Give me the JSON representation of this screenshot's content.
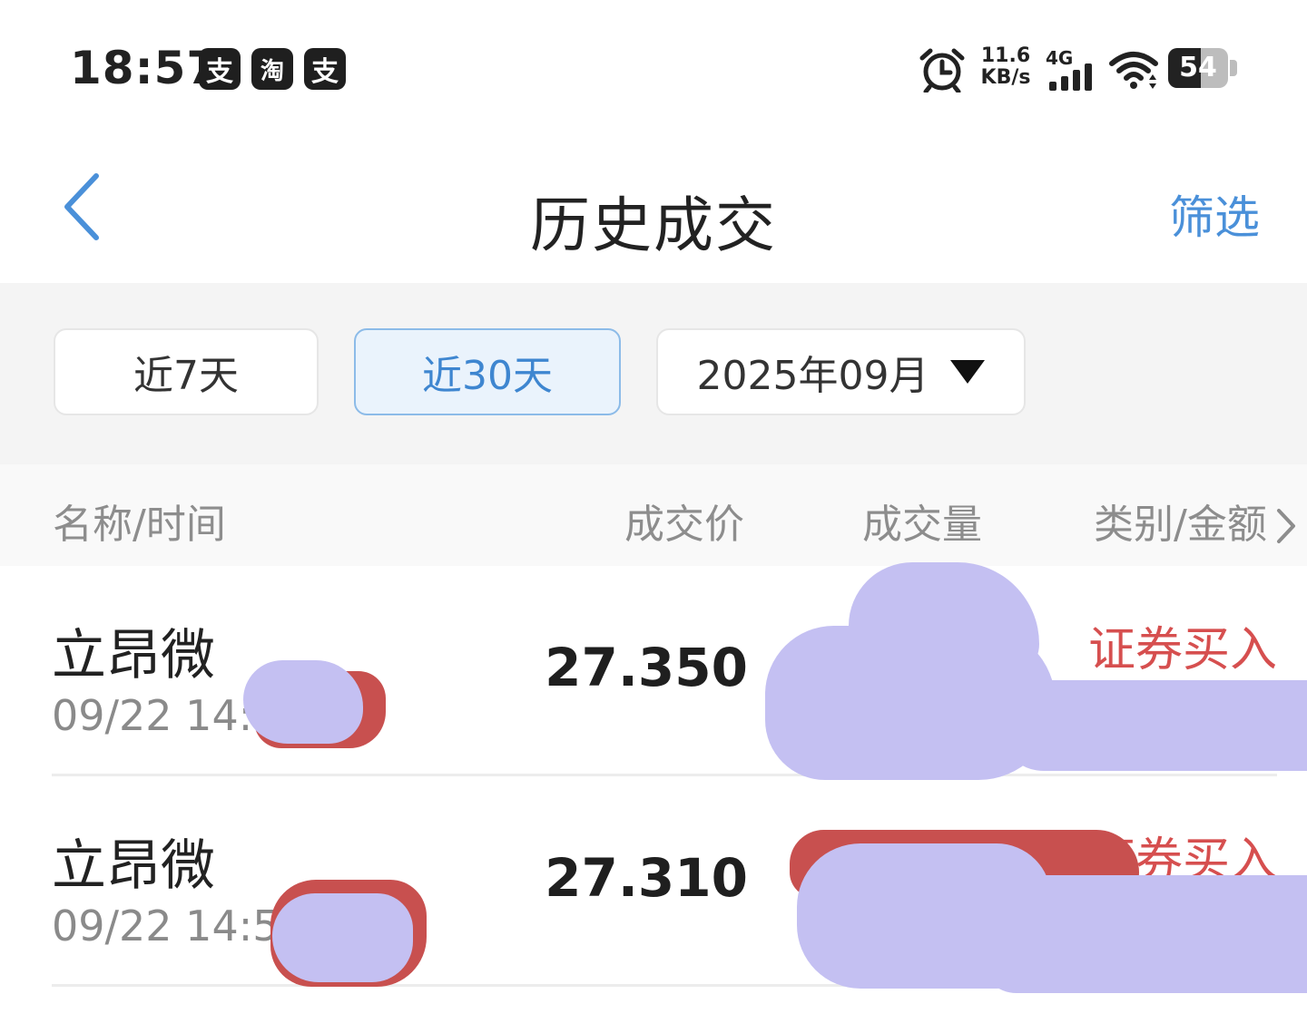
{
  "status_bar": {
    "time": "18:57",
    "app_icons": [
      {
        "glyph": "支",
        "icon": "alipay-icon"
      },
      {
        "glyph": "淘",
        "icon": "taobao-icon"
      },
      {
        "glyph": "支",
        "icon": "alipay-icon"
      }
    ],
    "net_speed_value": "11.6",
    "net_speed_unit": "KB/s",
    "net_type": "4G",
    "battery": "54",
    "battery_level": 0.54
  },
  "header": {
    "title": "历史成交",
    "filter_label": "筛选",
    "back_icon": "chevron-left-icon"
  },
  "range_options": {
    "last_7": "近7天",
    "last_30": "近30天",
    "month_picker": "2025年09月",
    "selected": "近30天"
  },
  "columns": {
    "name_time": "名称/时间",
    "price": "成交价",
    "volume": "成交量",
    "category_amount": "类别/金额"
  },
  "trades": [
    {
      "name": "立昂微",
      "time": "09/22 14:5",
      "price": "27.350",
      "category": "证券买入"
    },
    {
      "name": "立昂微",
      "time": "09/22 14:51",
      "price": "27.310",
      "category": "证券买入"
    }
  ],
  "colors": {
    "accent": "#4a90d9",
    "buy_red": "#d64f4f",
    "active_range_bg": "#eaf3fc"
  }
}
